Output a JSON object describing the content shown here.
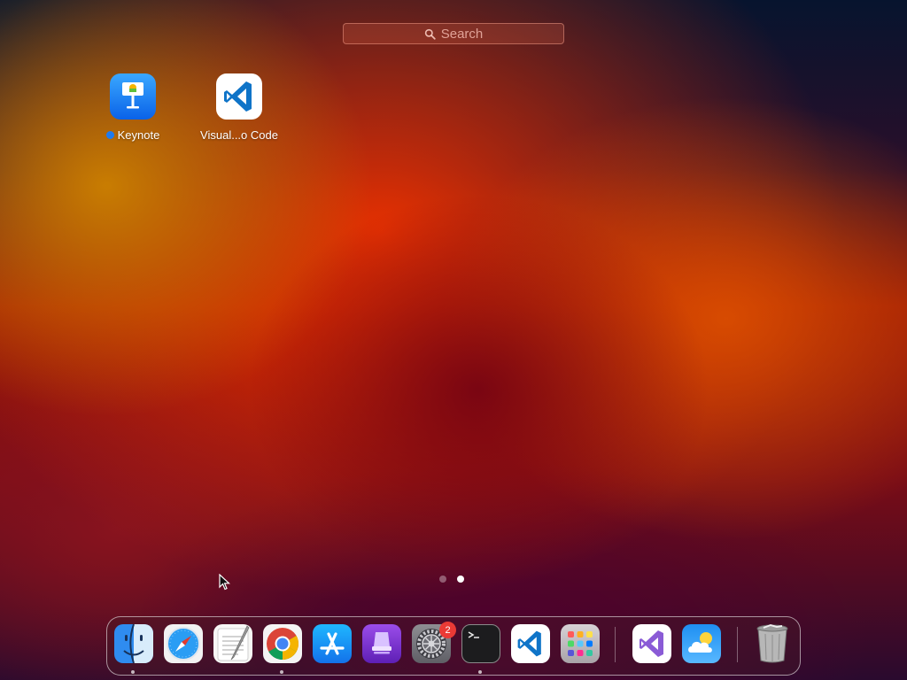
{
  "search": {
    "placeholder": "Search"
  },
  "apps": [
    {
      "name": "Keynote",
      "has_new_dot": true
    },
    {
      "name": "Visual...o Code"
    }
  ],
  "pager": {
    "pages": 2,
    "current": 2
  },
  "dock": {
    "items": [
      {
        "name": "Finder",
        "icon": "finder-icon",
        "running": true
      },
      {
        "name": "Safari",
        "icon": "safari-icon"
      },
      {
        "name": "TextEdit",
        "icon": "textedit-icon"
      },
      {
        "name": "Google Chrome",
        "icon": "chrome-icon",
        "running": true
      },
      {
        "name": "App Store",
        "icon": "app-store-icon"
      },
      {
        "name": "Podcasts-like app",
        "icon": "purple-app-icon"
      },
      {
        "name": "System Preferences",
        "icon": "settings-gear-icon",
        "badge": "2"
      },
      {
        "name": "Terminal",
        "icon": "terminal-icon",
        "running": true
      },
      {
        "name": "Visual Studio Code",
        "icon": "vscode-icon"
      },
      {
        "name": "Launchpad",
        "icon": "launchpad-icon"
      },
      {
        "name": "Visual Studio",
        "icon": "visual-studio-icon"
      },
      {
        "name": "Weather",
        "icon": "weather-icon"
      },
      {
        "name": "Trash",
        "icon": "trash-icon"
      }
    ]
  },
  "colors": {
    "accent_dot": "#1e7bf0",
    "badge": "#ea3a35"
  }
}
